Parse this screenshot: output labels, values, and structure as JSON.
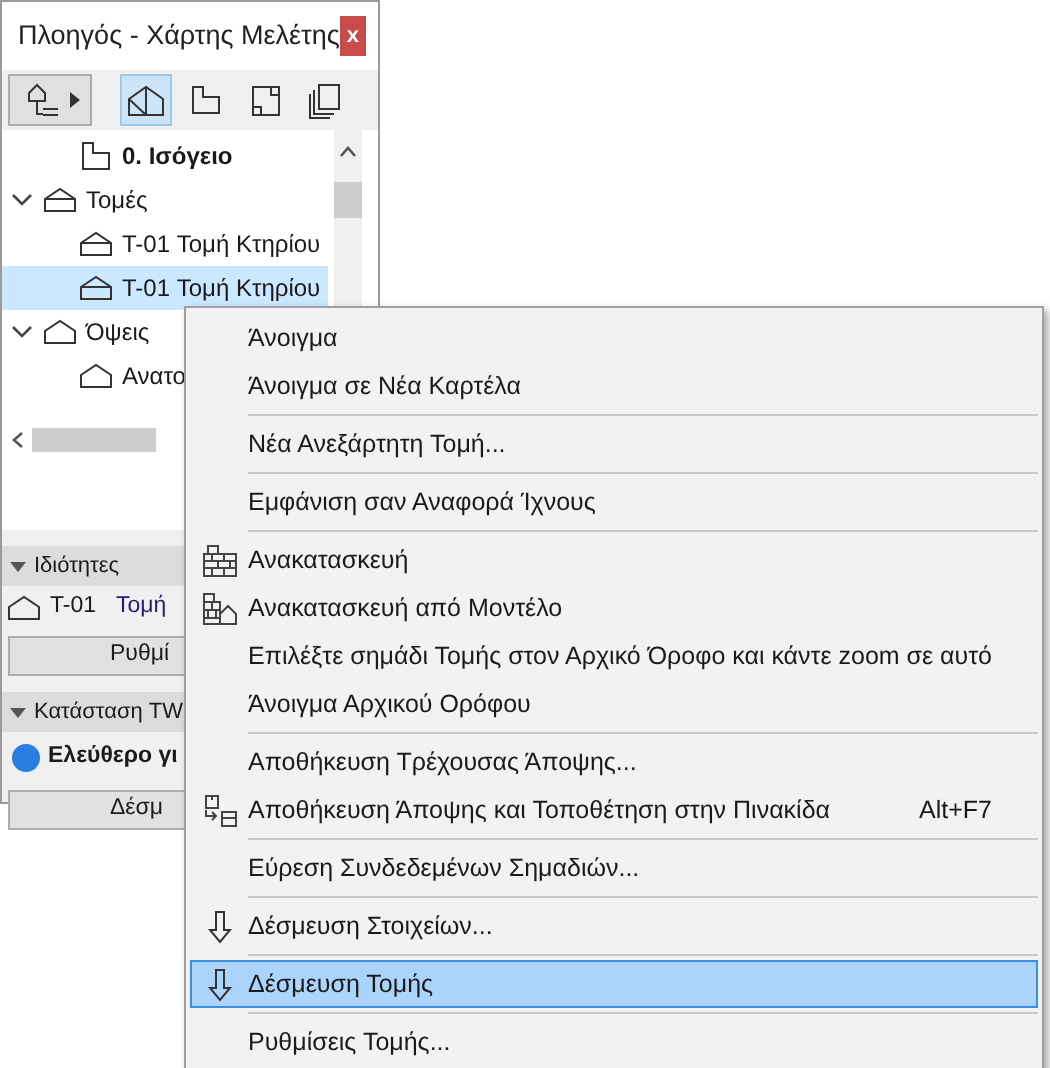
{
  "window": {
    "title": "Πλοηγός - Χάρτης Μελέτης",
    "close": "x"
  },
  "toolbar": [
    {
      "kind": "map",
      "selected": false
    },
    {
      "kind": "sections",
      "selected": true
    },
    {
      "kind": "story",
      "selected": false
    },
    {
      "kind": "layout",
      "selected": false
    },
    {
      "kind": "sets",
      "selected": false
    }
  ],
  "tree": [
    {
      "label": "0. Ισόγειο",
      "kind": "story",
      "selected": false,
      "bold": true
    },
    {
      "label": "Τομές",
      "kind": "section",
      "selected": false,
      "expanded": true,
      "children": [
        {
          "label": "T-01 Τομή Κτηρίου",
          "kind": "section",
          "selected": false
        },
        {
          "label": "T-01 Τομή Κτηρίου",
          "kind": "section",
          "selected": true
        }
      ]
    },
    {
      "label": "Όψεις",
      "kind": "elevation",
      "selected": false,
      "expanded": true,
      "children": [
        {
          "label": "Ανατο",
          "kind": "elevation",
          "selected": false
        }
      ]
    }
  ],
  "properties": {
    "title": "Ιδιότητες",
    "id": "T-01",
    "name": "Τομή",
    "button": "Ρυθμί"
  },
  "teamwork": {
    "title": "Κατάσταση TW",
    "status": "Ελεύθερο γι",
    "color": "#2a7de1",
    "button": "Δέσμ"
  },
  "menu": [
    {
      "kind": "item",
      "label": "Άνοιγμα",
      "selected": false
    },
    {
      "kind": "item",
      "label": "Άνοιγμα σε Νέα Καρτέλα",
      "selected": false
    },
    {
      "kind": "separator"
    },
    {
      "kind": "item",
      "label": "Νέα Ανεξάρτητη Τομή...",
      "selected": false
    },
    {
      "kind": "separator"
    },
    {
      "kind": "item",
      "label": "Εμφάνιση σαν Αναφορά Ίχνους",
      "selected": false
    },
    {
      "kind": "separator"
    },
    {
      "kind": "rebuild",
      "label": "Ανακατασκευή",
      "selected": false
    },
    {
      "kind": "rebuildmodel",
      "label": "Ανακατασκευή από Μοντέλο",
      "selected": false
    },
    {
      "kind": "item",
      "label": "Επιλέξτε σημάδι Τομής στον Αρχικό Όροφο και κάντε zoom σε αυτό",
      "selected": false
    },
    {
      "kind": "item",
      "label": "Άνοιγμα Αρχικού Ορόφου",
      "selected": false
    },
    {
      "kind": "separator"
    },
    {
      "kind": "item",
      "label": "Αποθήκευση Τρέχουσας Άποψης...",
      "selected": false
    },
    {
      "kind": "placeview",
      "label": "Αποθήκευση Άποψης και Τοποθέτηση στην Πινακίδα",
      "shortcut": "Alt+F7",
      "selected": false
    },
    {
      "kind": "separator"
    },
    {
      "kind": "item",
      "label": "Εύρεση Συνδεδεμένων Σημαδιών...",
      "selected": false
    },
    {
      "kind": "separator"
    },
    {
      "kind": "release",
      "label": "Δέσμευση Στοιχείων...",
      "selected": false
    },
    {
      "kind": "separator"
    },
    {
      "kind": "release",
      "label": "Δέσμευση Τομής",
      "selected": true
    },
    {
      "kind": "separator"
    },
    {
      "kind": "item",
      "label": "Ρυθμίσεις Τομής...",
      "selected": false
    }
  ]
}
